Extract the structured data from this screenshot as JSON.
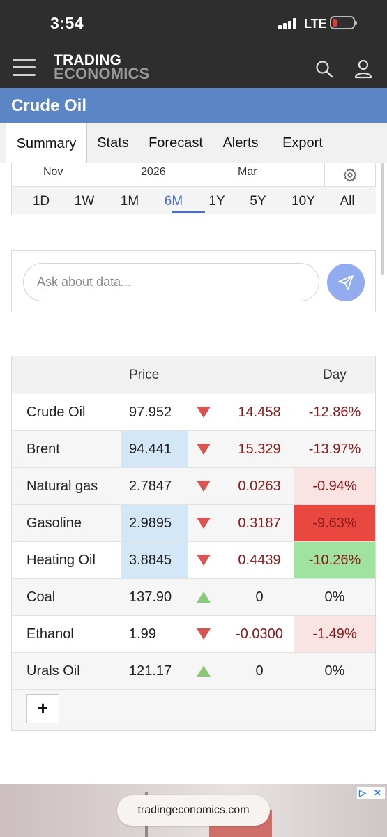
{
  "status_bar": {
    "time": "3:54",
    "network": "LTE"
  },
  "header": {
    "logo_line1": "TRADING",
    "logo_line2": "ECONOMICS"
  },
  "page": {
    "title": "Crude Oil"
  },
  "tabs": [
    {
      "label": "Summary",
      "active": true
    },
    {
      "label": "Stats"
    },
    {
      "label": "Forecast"
    },
    {
      "label": "Alerts"
    },
    {
      "label": "Export"
    }
  ],
  "chart": {
    "axis_labels": [
      "Nov",
      "2026",
      "Mar"
    ],
    "ranges": [
      "1D",
      "1W",
      "1M",
      "6M",
      "1Y",
      "5Y",
      "10Y",
      "All"
    ],
    "active_range": "6M"
  },
  "ask": {
    "placeholder": "Ask about data..."
  },
  "table": {
    "headers": {
      "price": "Price",
      "day": "Day"
    },
    "rows": [
      {
        "name": "Crude Oil",
        "price": "97.952",
        "direction": "down",
        "change": "14.458",
        "pct": "-12.86%"
      },
      {
        "name": "Brent",
        "price": "94.441",
        "direction": "down",
        "change": "15.329",
        "pct": "-13.97%"
      },
      {
        "name": "Natural gas",
        "price": "2.7847",
        "direction": "down",
        "change": "0.0263",
        "pct": "-0.94%"
      },
      {
        "name": "Gasoline",
        "price": "2.9895",
        "direction": "down",
        "change": "0.3187",
        "pct": "-9.63%"
      },
      {
        "name": "Heating Oil",
        "price": "3.8845",
        "direction": "down",
        "change": "0.4439",
        "pct": "-10.26%"
      },
      {
        "name": "Coal",
        "price": "137.90",
        "direction": "up",
        "change": "0",
        "pct": "0%"
      },
      {
        "name": "Ethanol",
        "price": "1.99",
        "direction": "down",
        "change": "-0.0300",
        "pct": "-1.49%"
      },
      {
        "name": "Urals Oil",
        "price": "121.17",
        "direction": "up",
        "change": "0",
        "pct": "0%"
      }
    ],
    "add_label": "+"
  },
  "ad": {
    "url_text": "tradingeconomics.com"
  },
  "colors": {
    "header_bg": "#2e2e2e",
    "title_bar": "#5b85c5",
    "accent": "#4a6fc4",
    "down_arrow": "#d9534f",
    "up_arrow": "#8bc97a",
    "price_highlight": "#d3e7f7",
    "pct_light_red": "#fae3e3",
    "pct_strong_red": "#e8483f",
    "pct_green": "#9fe3a0"
  }
}
